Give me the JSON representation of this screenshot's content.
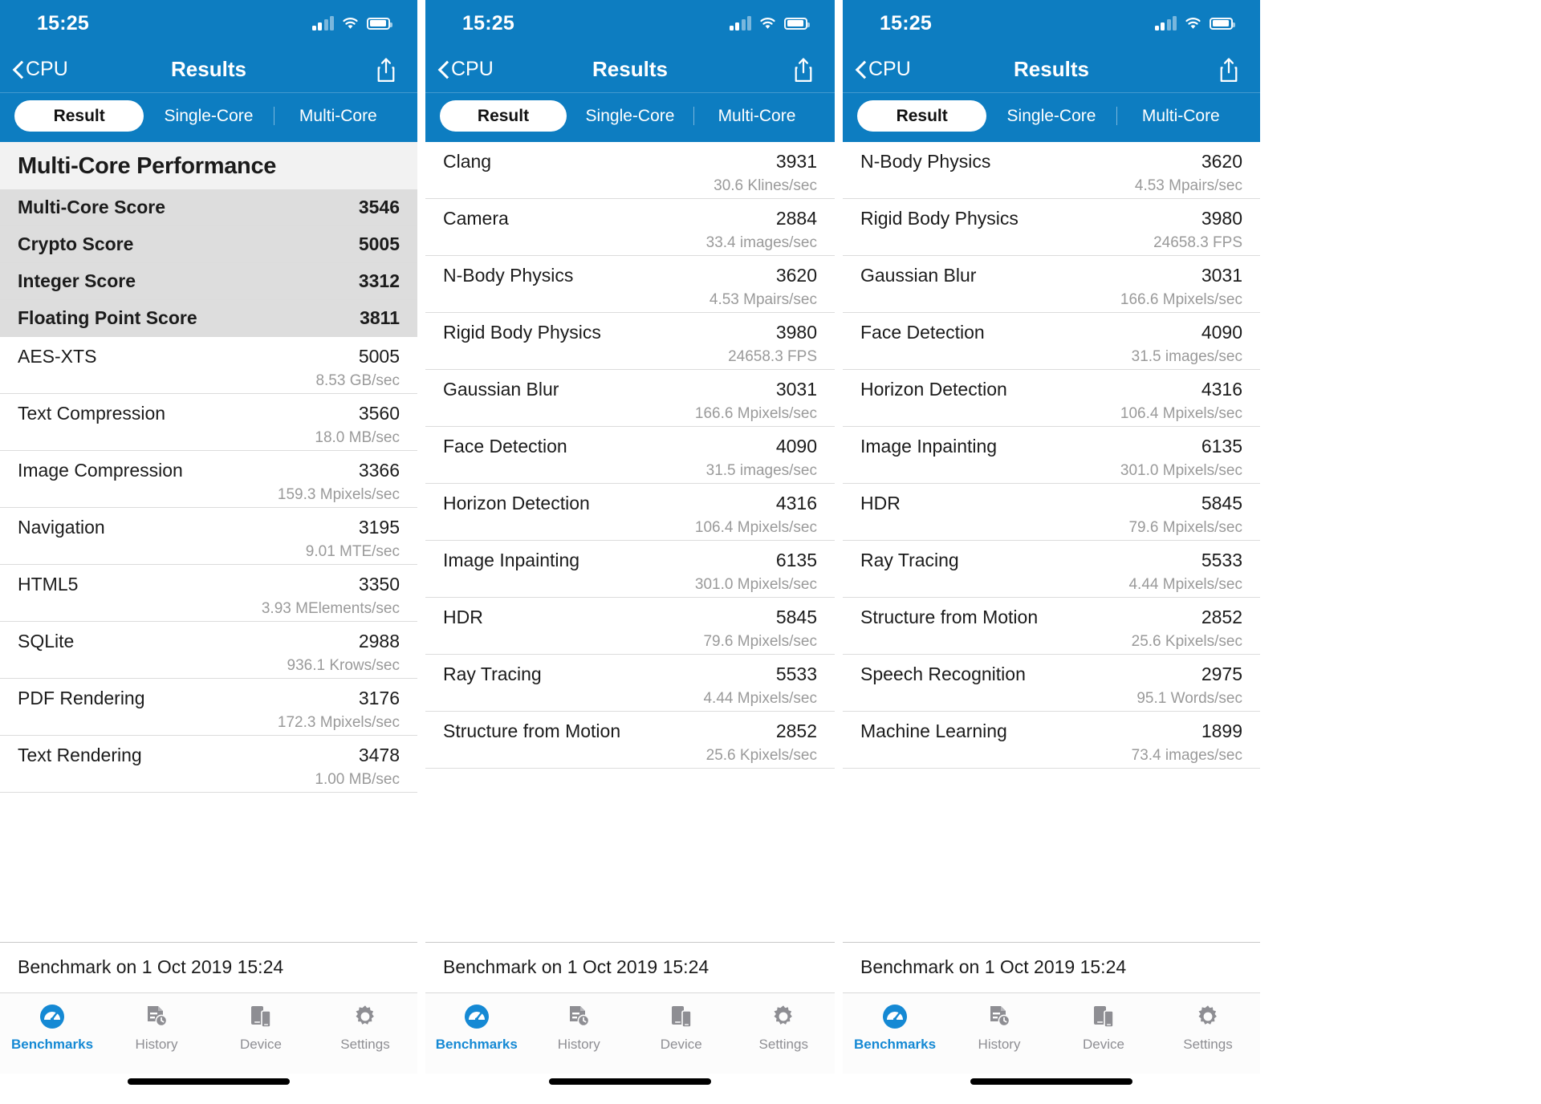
{
  "status": {
    "time": "15:25",
    "signal_icon": "cellular-signal-icon",
    "wifi_icon": "wifi-icon",
    "battery_icon": "battery-icon"
  },
  "nav": {
    "back_label": "CPU",
    "title": "Results",
    "back_icon": "chevron-left-icon",
    "share_icon": "share-icon"
  },
  "segments": [
    {
      "label": "Result",
      "active": true
    },
    {
      "label": "Single-Core",
      "active": false
    },
    {
      "label": "Multi-Core",
      "active": false
    }
  ],
  "colors": {
    "brand_blue": "#0d7dc1",
    "tab_active": "#1589d4",
    "score_row_bg": "#dddddd",
    "section_header_bg": "#f2f2f2",
    "subtext_gray": "#9a9a9a"
  },
  "footer_text": "Benchmark on 1 Oct 2019 15:24",
  "tabs": [
    {
      "label": "Benchmarks",
      "icon": "speedometer-icon",
      "active": true
    },
    {
      "label": "History",
      "icon": "document-clock-icon",
      "active": false
    },
    {
      "label": "Device",
      "icon": "devices-icon",
      "active": false
    },
    {
      "label": "Settings",
      "icon": "gear-icon",
      "active": false
    }
  ],
  "panel1": {
    "section_title": "Multi-Core Performance",
    "score_rows": [
      {
        "label": "Multi-Core Score",
        "value": "3546"
      },
      {
        "label": "Crypto Score",
        "value": "5005"
      },
      {
        "label": "Integer Score",
        "value": "3312"
      },
      {
        "label": "Floating Point Score",
        "value": "3811"
      }
    ],
    "bench_rows": [
      {
        "label": "AES-XTS",
        "value": "5005",
        "sub": "8.53 GB/sec"
      },
      {
        "label": "Text Compression",
        "value": "3560",
        "sub": "18.0 MB/sec"
      },
      {
        "label": "Image Compression",
        "value": "3366",
        "sub": "159.3 Mpixels/sec"
      },
      {
        "label": "Navigation",
        "value": "3195",
        "sub": "9.01 MTE/sec"
      },
      {
        "label": "HTML5",
        "value": "3350",
        "sub": "3.93 MElements/sec"
      },
      {
        "label": "SQLite",
        "value": "2988",
        "sub": "936.1 Krows/sec"
      },
      {
        "label": "PDF Rendering",
        "value": "3176",
        "sub": "172.3 Mpixels/sec"
      },
      {
        "label": "Text Rendering",
        "value": "3478",
        "sub": "1.00 MB/sec"
      }
    ]
  },
  "panel2": {
    "bench_rows": [
      {
        "label": "Clang",
        "value": "3931",
        "sub": "30.6 Klines/sec"
      },
      {
        "label": "Camera",
        "value": "2884",
        "sub": "33.4 images/sec"
      },
      {
        "label": "N-Body Physics",
        "value": "3620",
        "sub": "4.53 Mpairs/sec"
      },
      {
        "label": "Rigid Body Physics",
        "value": "3980",
        "sub": "24658.3 FPS"
      },
      {
        "label": "Gaussian Blur",
        "value": "3031",
        "sub": "166.6 Mpixels/sec"
      },
      {
        "label": "Face Detection",
        "value": "4090",
        "sub": "31.5 images/sec"
      },
      {
        "label": "Horizon Detection",
        "value": "4316",
        "sub": "106.4 Mpixels/sec"
      },
      {
        "label": "Image Inpainting",
        "value": "6135",
        "sub": "301.0 Mpixels/sec"
      },
      {
        "label": "HDR",
        "value": "5845",
        "sub": "79.6 Mpixels/sec"
      },
      {
        "label": "Ray Tracing",
        "value": "5533",
        "sub": "4.44 Mpixels/sec"
      },
      {
        "label": "Structure from Motion",
        "value": "2852",
        "sub": "25.6 Kpixels/sec"
      }
    ]
  },
  "panel3": {
    "bench_rows": [
      {
        "label": "N-Body Physics",
        "value": "3620",
        "sub": "4.53 Mpairs/sec"
      },
      {
        "label": "Rigid Body Physics",
        "value": "3980",
        "sub": "24658.3 FPS"
      },
      {
        "label": "Gaussian Blur",
        "value": "3031",
        "sub": "166.6 Mpixels/sec"
      },
      {
        "label": "Face Detection",
        "value": "4090",
        "sub": "31.5 images/sec"
      },
      {
        "label": "Horizon Detection",
        "value": "4316",
        "sub": "106.4 Mpixels/sec"
      },
      {
        "label": "Image Inpainting",
        "value": "6135",
        "sub": "301.0 Mpixels/sec"
      },
      {
        "label": "HDR",
        "value": "5845",
        "sub": "79.6 Mpixels/sec"
      },
      {
        "label": "Ray Tracing",
        "value": "5533",
        "sub": "4.44 Mpixels/sec"
      },
      {
        "label": "Structure from Motion",
        "value": "2852",
        "sub": "25.6 Kpixels/sec"
      },
      {
        "label": "Speech Recognition",
        "value": "2975",
        "sub": "95.1 Words/sec"
      },
      {
        "label": "Machine Learning",
        "value": "1899",
        "sub": "73.4 images/sec"
      }
    ]
  }
}
